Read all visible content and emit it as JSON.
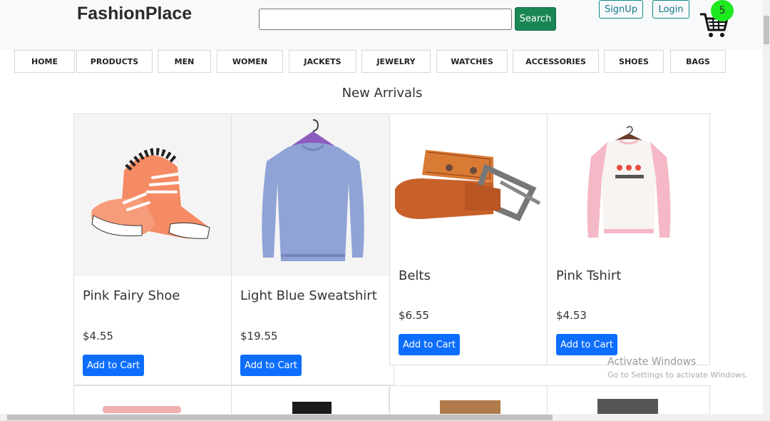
{
  "header": {
    "brand": "FashionPlace",
    "search_value": "",
    "search_label": "Search",
    "signup_label": "SignUp",
    "login_label": "Login",
    "cart_count": "5"
  },
  "nav": [
    {
      "label": "HOME"
    },
    {
      "label": "PRODUCTS"
    },
    {
      "label": "MEN"
    },
    {
      "label": "WOMEN"
    },
    {
      "label": "JACKETS"
    },
    {
      "label": "JEWELRY"
    },
    {
      "label": "WATCHES"
    },
    {
      "label": "ACCESSORIES"
    },
    {
      "label": "SHOES"
    },
    {
      "label": "BAGS"
    }
  ],
  "section_title": "New Arrivals",
  "products": [
    {
      "name": "Pink Fairy Shoe",
      "price": "$4.55",
      "button": "Add to Cart",
      "icon": "shoe-image"
    },
    {
      "name": "Light Blue Sweatshirt",
      "price": "$19.55",
      "button": "Add to Cart",
      "icon": "sweatshirt-image"
    },
    {
      "name": "Belts",
      "price": "$6.55",
      "button": "Add to Cart",
      "icon": "belt-image"
    },
    {
      "name": "Pink Tshirt",
      "price": "$4.53",
      "button": "Add to Cart",
      "icon": "tshirt-image"
    }
  ],
  "watermark": {
    "title": "Activate Windows",
    "subtitle": "Go to Settings to activate Windows."
  },
  "colors": {
    "search_button": "#198754",
    "add_to_cart": "#0d6efd",
    "cart_badge": "#1ee81e",
    "outline_accent": "#117a8b"
  }
}
